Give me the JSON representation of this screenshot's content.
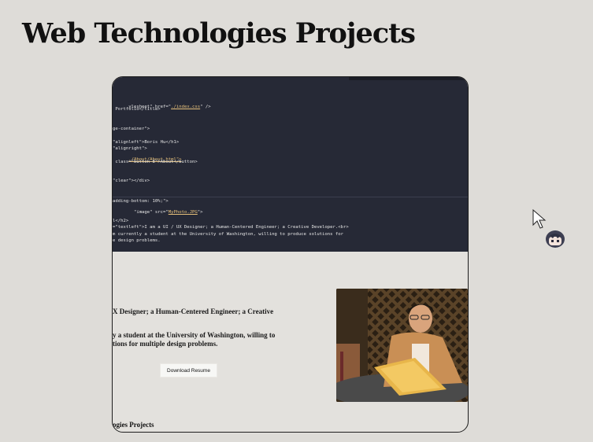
{
  "page": {
    "title": "Web Technologies Projects"
  },
  "code": {
    "lines": [
      {
        "a": "ylesheet\" href=\"",
        "b": "./index.css",
        "c": "\" />"
      },
      {
        "a": " Portfolio</title>"
      },
      {
        "a": "ge-container\">"
      },
      {
        "a": "\"alignleft\">Boris Hu</h1>"
      },
      {
        "a": "\"alignright\">"
      },
      {
        "a": "./About/About.html\">"
      },
      {
        "a": " class=\"button-8\">About</button>"
      },
      {
        "a": "\"clear\"></div>"
      },
      {
        "a": "adding-bottom: 10%;\">"
      },
      {
        "a": "  \"image\" src=\"",
        "b": "MyPhoto.JPG",
        "c": "\">"
      },
      {
        "a": "l</h2>"
      },
      {
        "a": "=\"textleft\">I am a UI / UX Designer; a Human-Centered Engineer; a Creative Developer.<br>"
      },
      {
        "a": "m currently a student at the University of Washington, willing to produce solutions for"
      },
      {
        "a": "e design problems."
      }
    ]
  },
  "preview": {
    "intro_line": "X Designer; a Human-Centered Engineer; a Creative",
    "student_line_1": "y a student at the University of Washington, willing to",
    "student_line_2": "tions for multiple design problems.",
    "download_button": "Download Resume",
    "footer_title": "ogies Projects"
  }
}
